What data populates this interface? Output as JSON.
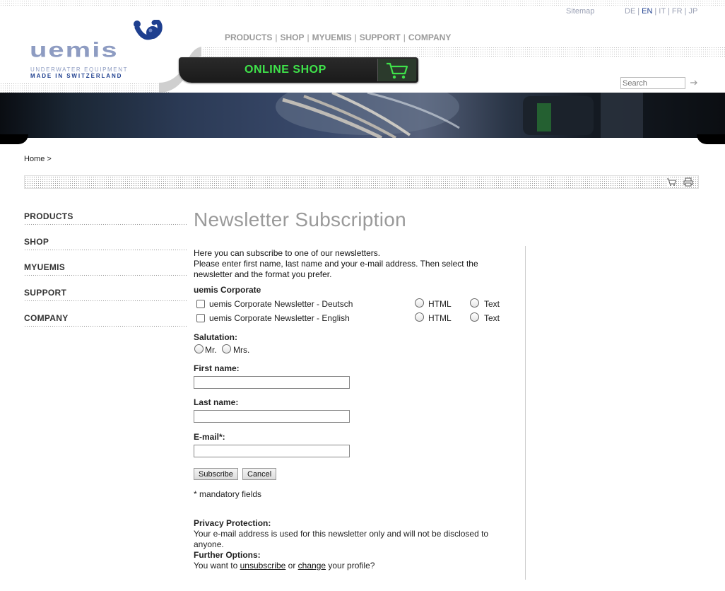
{
  "header": {
    "sitemap": "Sitemap",
    "languages": [
      "DE",
      "EN",
      "IT",
      "FR",
      "JP"
    ],
    "active_language": "EN",
    "logo": {
      "word": "uemis",
      "tagline1": "UNDERWATER EQUIPMENT",
      "tagline2": "MADE IN SWITZERLAND"
    },
    "nav": [
      "PRODUCTS",
      "SHOP",
      "MYUEMIS",
      "SUPPORT",
      "COMPANY"
    ],
    "shop_button": "ONLINE SHOP",
    "search_placeholder": "Search"
  },
  "breadcrumb": "Home >",
  "sidebar": {
    "items": [
      "PRODUCTS",
      "SHOP",
      "MYUEMIS",
      "SUPPORT",
      "COMPANY"
    ]
  },
  "main": {
    "title": "Newsletter Subscription",
    "intro1": "Here you can subscribe to one of our newsletters.",
    "intro2": "Please enter first name, last name and your e-mail address. Then select the newsletter and the format you prefer.",
    "group_title": "uemis Corporate",
    "newsletters": [
      {
        "name": "uemis Corporate Newsletter - Deutsch",
        "opt1": "HTML",
        "opt2": "Text"
      },
      {
        "name": "uemis Corporate Newsletter - English",
        "opt1": "HTML",
        "opt2": "Text"
      }
    ],
    "salutation_label": "Salutation:",
    "salutation_options": [
      "Mr.",
      "Mrs."
    ],
    "first_name_label": "First name:",
    "last_name_label": "Last name:",
    "email_label": "E-mail*:",
    "subscribe_button": "Subscribe",
    "cancel_button": "Cancel",
    "mandatory_note": "* mandatory fields",
    "privacy_title": "Privacy Protection:",
    "privacy_text": "Your e-mail address is used for this newsletter only and will not be disclosed to anyone.",
    "further_title": "Further Options:",
    "further_prefix": "You want to ",
    "unsubscribe_link": "unsubscribe",
    "further_mid": " or ",
    "change_link": "change",
    "further_suffix": " your profile?"
  },
  "colors": {
    "brand_blue": "#1e3f8f",
    "brand_light": "#8e9cc2",
    "shop_green": "#3fe34a"
  }
}
